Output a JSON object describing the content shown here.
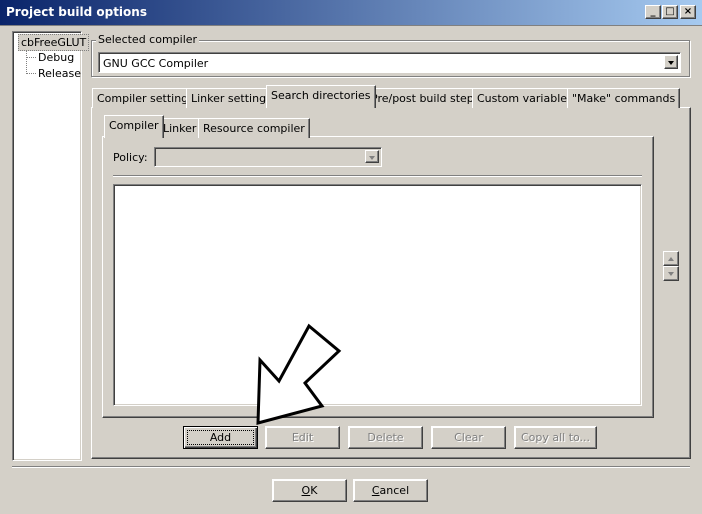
{
  "window": {
    "title": "Project build options",
    "minimize": "_",
    "maximize": "□",
    "close": "×"
  },
  "tree": {
    "root": "cbFreeGLUT",
    "children": [
      "Debug",
      "Release"
    ]
  },
  "compiler": {
    "group_label": "Selected compiler",
    "selected": "GNU GCC Compiler"
  },
  "tabs": [
    "Compiler settings",
    "Linker settings",
    "Search directories",
    "Pre/post build steps",
    "Custom variables",
    "\"Make\" commands"
  ],
  "subtabs": [
    "Compiler",
    "Linker",
    "Resource compiler"
  ],
  "policy": {
    "label": "Policy:",
    "value": ""
  },
  "buttons": {
    "add": "Add",
    "edit": "Edit",
    "delete": "Delete",
    "clear": "Clear",
    "copy_all": "Copy all to..."
  },
  "dialog": {
    "ok_underline": "O",
    "ok_rest": "K",
    "cancel_underline": "C",
    "cancel_rest": "ancel"
  }
}
